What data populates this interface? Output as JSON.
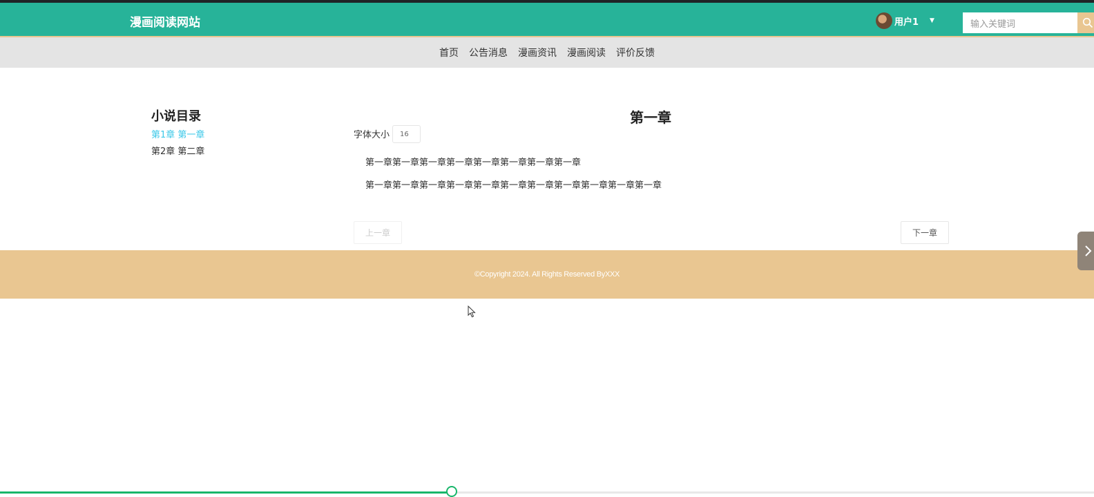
{
  "header": {
    "site_title": "漫画阅读网站",
    "user_label": "用户1",
    "search_placeholder": "输入关键词"
  },
  "nav": {
    "items": [
      "首页",
      "公告消息",
      "漫画资讯",
      "漫画阅读",
      "评价反馈"
    ]
  },
  "toc": {
    "title": "小说目录",
    "items": [
      {
        "label": "第1章 第一章",
        "active": true
      },
      {
        "label": "第2章 第二章",
        "active": false
      }
    ]
  },
  "chapter": {
    "title": "第一章",
    "font_size_label": "字体大小",
    "font_size_value": "16",
    "paragraphs": [
      "第一章第一章第一章第一章第一章第一章第一章第一章",
      "第一章第一章第一章第一章第一章第一章第一章第一章第一章第一章第一章"
    ],
    "prev_label": "上一章",
    "next_label": "下一章"
  },
  "footer": {
    "copyright": "©Copyright 2024. All Rights Reserved ByXXX"
  },
  "video_progress": {
    "fraction": 0.413
  },
  "colors": {
    "header_bg": "#27b399",
    "accent": "#e9c691",
    "active_link": "#3cc8e8",
    "progress": "#18b66a"
  },
  "icons": [
    "search-icon",
    "chevron-down-icon",
    "chevron-right-icon",
    "mouse-cursor-icon"
  ]
}
